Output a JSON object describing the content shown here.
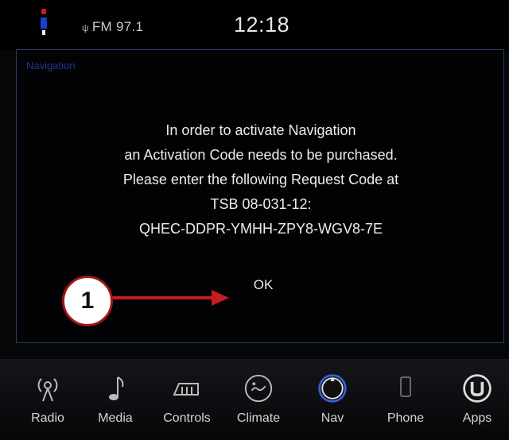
{
  "statusbar": {
    "radio_station": "FM 97.1",
    "clock": "12:18"
  },
  "dialog": {
    "title": "Navigation",
    "message_lines": [
      "In order to activate Navigation",
      "an Activation Code needs to be purchased.",
      "Please enter the following Request Code at",
      "TSB 08-031-12:",
      "QHEC-DDPR-YMHH-ZPY8-WGV8-7E"
    ],
    "ok_label": "OK"
  },
  "callout": {
    "number": "1",
    "color": "#c41e1e"
  },
  "navbar": {
    "items": [
      {
        "label": "Radio",
        "icon": "radio-icon"
      },
      {
        "label": "Media",
        "icon": "media-icon"
      },
      {
        "label": "Controls",
        "icon": "controls-icon"
      },
      {
        "label": "Climate",
        "icon": "climate-icon"
      },
      {
        "label": "Nav",
        "icon": "nav-icon",
        "active": true
      },
      {
        "label": "Phone",
        "icon": "phone-icon"
      },
      {
        "label": "Apps",
        "icon": "apps-icon"
      }
    ]
  },
  "colors": {
    "background": "#050608",
    "dialog_border": "#2a3b66",
    "nav_accent": "#3a5fd0",
    "callout_red": "#c41e1e"
  }
}
